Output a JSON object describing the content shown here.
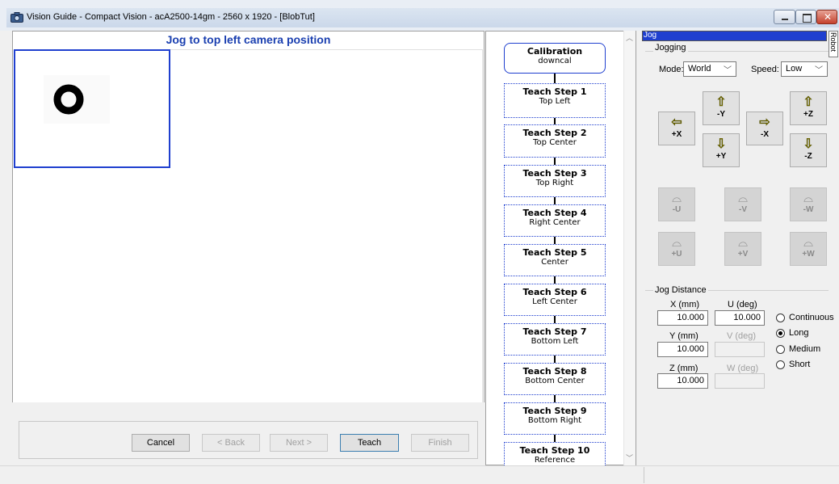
{
  "window": {
    "title": "Vision Guide - Compact Vision - acA2500-14gm - 2560 x 1920 - [BlobTut]",
    "app_icon": "camera-icon",
    "controls": [
      "minimize-icon",
      "maximize-icon",
      "close-icon"
    ]
  },
  "wizard": {
    "heading": "Jog to top left camera position",
    "buttons": {
      "cancel": "Cancel",
      "back": "< Back",
      "next": "Next >",
      "teach": "Teach",
      "finish": "Finish"
    }
  },
  "steps": [
    {
      "title": "Calibration",
      "subtitle": "downcal",
      "active": true
    },
    {
      "title": "Teach Step 1",
      "subtitle": "Top Left"
    },
    {
      "title": "Teach Step 2",
      "subtitle": "Top Center"
    },
    {
      "title": "Teach Step 3",
      "subtitle": "Top Right"
    },
    {
      "title": "Teach Step 4",
      "subtitle": "Right Center"
    },
    {
      "title": "Teach Step 5",
      "subtitle": "Center"
    },
    {
      "title": "Teach Step 6",
      "subtitle": "Left Center"
    },
    {
      "title": "Teach Step 7",
      "subtitle": "Bottom Left"
    },
    {
      "title": "Teach Step 8",
      "subtitle": "Bottom Center"
    },
    {
      "title": "Teach Step 9",
      "subtitle": "Bottom Right"
    },
    {
      "title": "Teach Step 10",
      "subtitle": "Reference"
    }
  ],
  "jog": {
    "tab": "Jog",
    "side_tab": "Robot",
    "jogging_group": "Jogging",
    "mode_label": "Mode:",
    "mode_value": "World",
    "speed_label": "Speed:",
    "speed_value": "Low",
    "buttons": {
      "plus_x": "+X",
      "minus_y": "-Y",
      "plus_y": "+Y",
      "minus_x": "-X",
      "plus_z": "+Z",
      "minus_z": "-Z",
      "minus_u": "-U",
      "minus_v": "-V",
      "minus_w": "-W",
      "plus_u": "+U",
      "plus_v": "+V",
      "plus_w": "+W"
    },
    "distance_group": "Jog Distance",
    "x_label": "X (mm)",
    "x_value": "10.000",
    "u_label": "U (deg)",
    "u_value": "10.000",
    "y_label": "Y (mm)",
    "y_value": "10.000",
    "v_label": "V (deg)",
    "z_label": "Z (mm)",
    "z_value": "10.000",
    "w_label": "W (deg)",
    "radios": {
      "continuous": "Continuous",
      "long": "Long",
      "medium": "Medium",
      "short": "Short",
      "selected": "Long"
    }
  }
}
